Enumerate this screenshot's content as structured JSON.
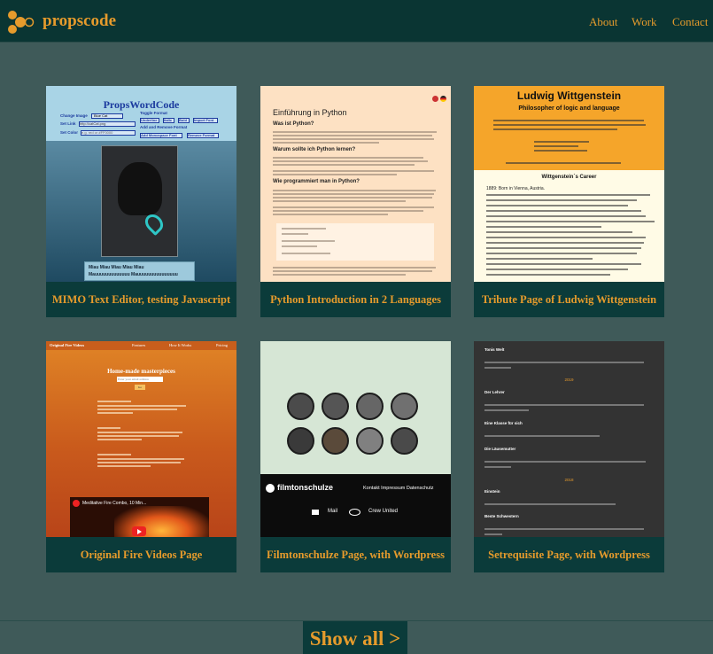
{
  "header": {
    "brand": "propscode",
    "nav": [
      "About",
      "Work",
      "Contact"
    ]
  },
  "colors": {
    "accent": "#e69b2c",
    "header_bg": "#0a3533",
    "page_bg": "#3f5a59",
    "card_bg": "#0b3b3a"
  },
  "projects": [
    {
      "caption": "MIMO Text Editor, testing Javascript",
      "thumb": {
        "title": "PropsWordCode",
        "change_image": "Change Image",
        "select_value": "Blue Cat",
        "toggle_format": "Toggle Format",
        "buttons": [
          "Underline",
          "Italic",
          "Bold",
          "Import Font"
        ],
        "add_remove": "Add and Remove Format",
        "url_label": "Set Link",
        "url_value": "http://catCat.png",
        "color_label": "Set Color",
        "color_value": "e.g. red or #FF0000",
        "format_buttons": [
          "Add Monospace Font",
          "Remove Format"
        ],
        "text_line1": "Miau Miau Miau Miau Miau",
        "text_line2": "Mauuuuuuuuuuuuu Mauuuuuuuuuuuuuuu"
      }
    },
    {
      "caption": "Python Introduction in 2 Languages",
      "thumb": {
        "heading1": "Einführung in Python",
        "heading2": "Was ist Python?",
        "heading3": "Warum sollte ich Python lernen?",
        "heading4": "Wie programmiert man in Python?"
      }
    },
    {
      "caption": "Tribute Page of Ludwig Wittgenstein",
      "thumb": {
        "name": "Ludwig Wittgenstein",
        "subtitle": "Philosopher of logic and language",
        "career": "Wittgenstein´s Career",
        "first_entry": "1889: Born in Vienna, Austria."
      }
    },
    {
      "caption": "Original Fire Videos Page",
      "thumb": {
        "brand": "Original Fire Videos",
        "nav": [
          "Features",
          "How It Works",
          "Pricing"
        ],
        "headline": "Home-made masterpieces",
        "input_placeholder": "Enter your email address",
        "button": "Go",
        "video_title": "Meditative Fire Combo, 10 Min..."
      }
    },
    {
      "caption": "Filmtonschulze Page, with Wordpress",
      "thumb": {
        "logo": "filmtonschulze",
        "links": "Kontakt  Impressum  Datenschutz",
        "mail": "Mail",
        "crew": "Crew United"
      }
    },
    {
      "caption": "Setrequisite Page, with Wordpress",
      "thumb": {
        "first_title": "Tonis Welt",
        "year1": "2019",
        "entries": [
          "Der Lehrer",
          "Eine Klasse für sich",
          "Die Läusemutter"
        ],
        "year2": "2018",
        "entries2": [
          "Einstein",
          "Beste Schwestern"
        ]
      }
    }
  ],
  "show_all": "Show all >"
}
